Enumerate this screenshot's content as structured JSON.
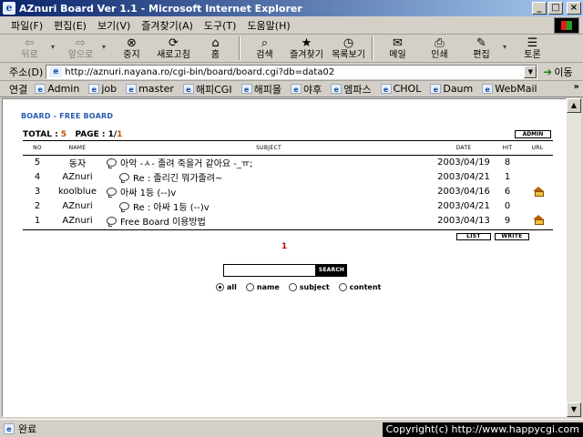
{
  "window": {
    "title": "AZnuri Board Ver 1.1 - Microsoft Internet Explorer"
  },
  "menu": [
    "파일(F)",
    "편집(E)",
    "보기(V)",
    "즐겨찾기(A)",
    "도구(T)",
    "도움말(H)"
  ],
  "toolbar": {
    "back": "뒤로",
    "forward": "앞으로",
    "stop": "중지",
    "refresh": "새로고침",
    "home": "홈",
    "search": "검색",
    "favorites": "즐겨찾기",
    "history": "목록보기",
    "mail": "메일",
    "print": "인쇄",
    "edit": "편집",
    "discuss": "토론"
  },
  "address": {
    "label": "주소(D)",
    "url": "http://aznuri.nayana.ro/cgi-bin/board/board.cgi?db=data02",
    "go": "이동"
  },
  "links": {
    "label": "연결",
    "items": [
      "Admin",
      "job",
      "master",
      "해피CGI",
      "해피몰",
      "야후",
      "엠파스",
      "CHOL",
      "Daum",
      "WebMail"
    ]
  },
  "board": {
    "title": "BOARD - FREE BOARD",
    "total_label": "TOTAL : ",
    "total": "5",
    "page_label": "PAGE : ",
    "page_current": "1",
    "page_sep": "/",
    "page_total": "1",
    "admin": "ADMIN",
    "columns": {
      "no": "NO",
      "name": "NAME",
      "subject": "SUBJECT",
      "date": "DATE",
      "hit": "HIT",
      "url": "URL"
    },
    "rows": [
      {
        "no": "5",
        "name": "동자",
        "subject": "아악 -ㅅ- 졸려 죽을거 같아요 -_ㅠ;",
        "date": "2003/04/19",
        "hit": "8",
        "reply": false,
        "url": false
      },
      {
        "no": "4",
        "name": "AZnuri",
        "subject": "Re : 졸리긴 뭐가졸려~",
        "date": "2003/04/21",
        "hit": "1",
        "reply": true,
        "url": false
      },
      {
        "no": "3",
        "name": "koolblue",
        "subject": "아싸 1등 (--)v",
        "date": "2003/04/16",
        "hit": "6",
        "reply": false,
        "url": true
      },
      {
        "no": "2",
        "name": "AZnuri",
        "subject": "Re : 아싸 1등 (--)v",
        "date": "2003/04/21",
        "hit": "0",
        "reply": true,
        "url": false
      },
      {
        "no": "1",
        "name": "AZnuri",
        "subject": "Free Board 이용방법",
        "date": "2003/04/13",
        "hit": "9",
        "reply": false,
        "url": true
      }
    ],
    "list_btn": "LIST",
    "write_btn": "WRITE",
    "page_number": "1",
    "search_btn": "SEARCH",
    "search_value": "",
    "radios": [
      {
        "label": "all",
        "checked": true
      },
      {
        "label": "name",
        "checked": false
      },
      {
        "label": "subject",
        "checked": false
      },
      {
        "label": "content",
        "checked": false
      }
    ]
  },
  "status": {
    "text": "완료"
  },
  "copyright": "Copyright(c) http://www.happycgi.com"
}
